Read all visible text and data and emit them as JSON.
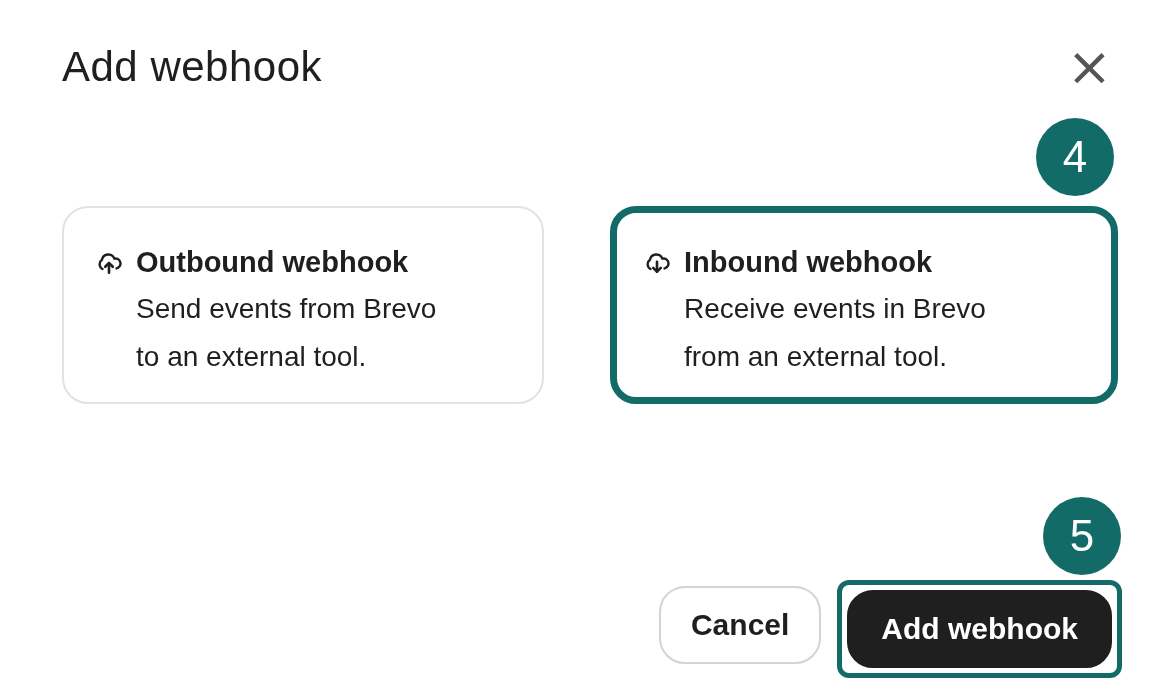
{
  "dialog": {
    "title": "Add webhook",
    "close": "×"
  },
  "options": [
    {
      "kind": "outbound",
      "title": "Outbound webhook",
      "description": "Send events from Brevo to an external tool.",
      "highlighted": false
    },
    {
      "kind": "inbound",
      "title": "Inbound webhook",
      "description": "Receive events in Brevo from an external tool.",
      "highlighted": true,
      "step": "4"
    }
  ],
  "buttons": [
    {
      "kind": "secondary",
      "label": "Cancel",
      "highlighted": false
    },
    {
      "kind": "primary",
      "label": "Add webhook",
      "highlighted": true,
      "step": "5"
    }
  ]
}
